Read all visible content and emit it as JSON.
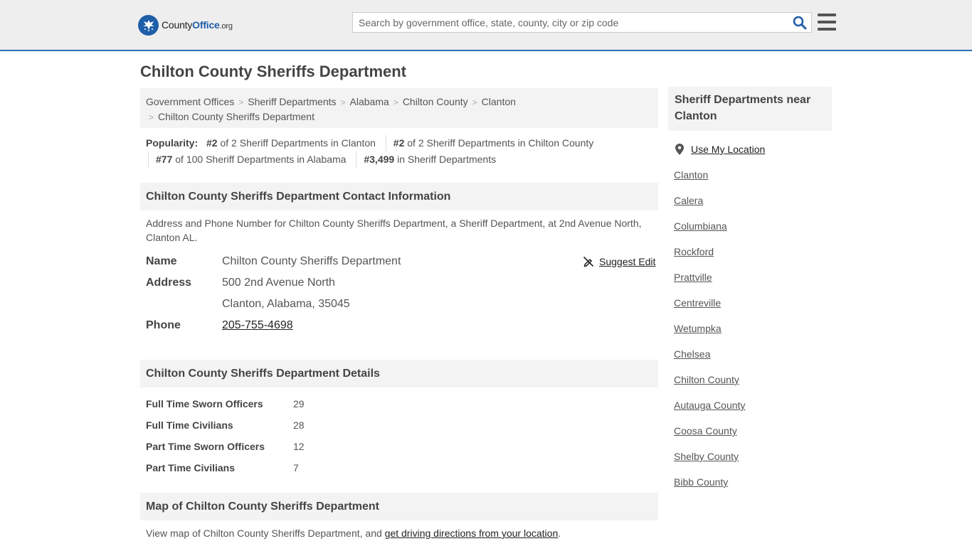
{
  "header": {
    "logo_text_county": "County",
    "logo_text_office": "Office",
    "logo_text_org": ".org",
    "search_placeholder": "Search by government office, state, county, city or zip code",
    "colors": {
      "header_bg": "#eeeeee",
      "accent": "#2b6fb6"
    }
  },
  "page_title": "Chilton County Sheriffs Department",
  "breadcrumb": [
    "Government Offices",
    "Sheriff Departments",
    "Alabama",
    "Chilton County",
    "Clanton",
    "Chilton County Sheriffs Department"
  ],
  "popularity": {
    "label": "Popularity:",
    "items": [
      {
        "rank": "#2",
        "text": "of 2 Sheriff Departments in Clanton"
      },
      {
        "rank": "#2",
        "text": "of 2 Sheriff Departments in Chilton County"
      },
      {
        "rank": "#77",
        "text": "of 100 Sheriff Departments in Alabama"
      },
      {
        "rank": "#3,499",
        "text": "in Sheriff Departments"
      }
    ]
  },
  "contact": {
    "heading": "Chilton County Sheriffs Department Contact Information",
    "description": "Address and Phone Number for Chilton County Sheriffs Department, a Sheriff Department, at 2nd Avenue North, Clanton AL.",
    "suggest_edit": "Suggest Edit",
    "name_label": "Name",
    "name_value": "Chilton County Sheriffs Department",
    "address_label": "Address",
    "address_line1": "500 2nd Avenue North",
    "address_line2": "Clanton, Alabama, 35045",
    "phone_label": "Phone",
    "phone_value": "205-755-4698"
  },
  "details": {
    "heading": "Chilton County Sheriffs Department Details",
    "rows": [
      {
        "label": "Full Time Sworn Officers",
        "value": "29"
      },
      {
        "label": "Full Time Civilians",
        "value": "28"
      },
      {
        "label": "Part Time Sworn Officers",
        "value": "12"
      },
      {
        "label": "Part Time Civilians",
        "value": "7"
      }
    ]
  },
  "map": {
    "heading": "Map of Chilton County Sheriffs Department",
    "desc_prefix": "View map of Chilton County Sheriffs Department, and ",
    "desc_link": "get driving directions from your location",
    "desc_suffix": "."
  },
  "sidebar": {
    "heading": "Sheriff Departments near Clanton",
    "use_location": "Use My Location",
    "links": [
      "Clanton",
      "Calera",
      "Columbiana",
      "Rockford",
      "Prattville",
      "Centreville",
      "Wetumpka",
      "Chelsea",
      "Chilton County",
      "Autauga County",
      "Coosa County",
      "Shelby County",
      "Bibb County"
    ]
  }
}
